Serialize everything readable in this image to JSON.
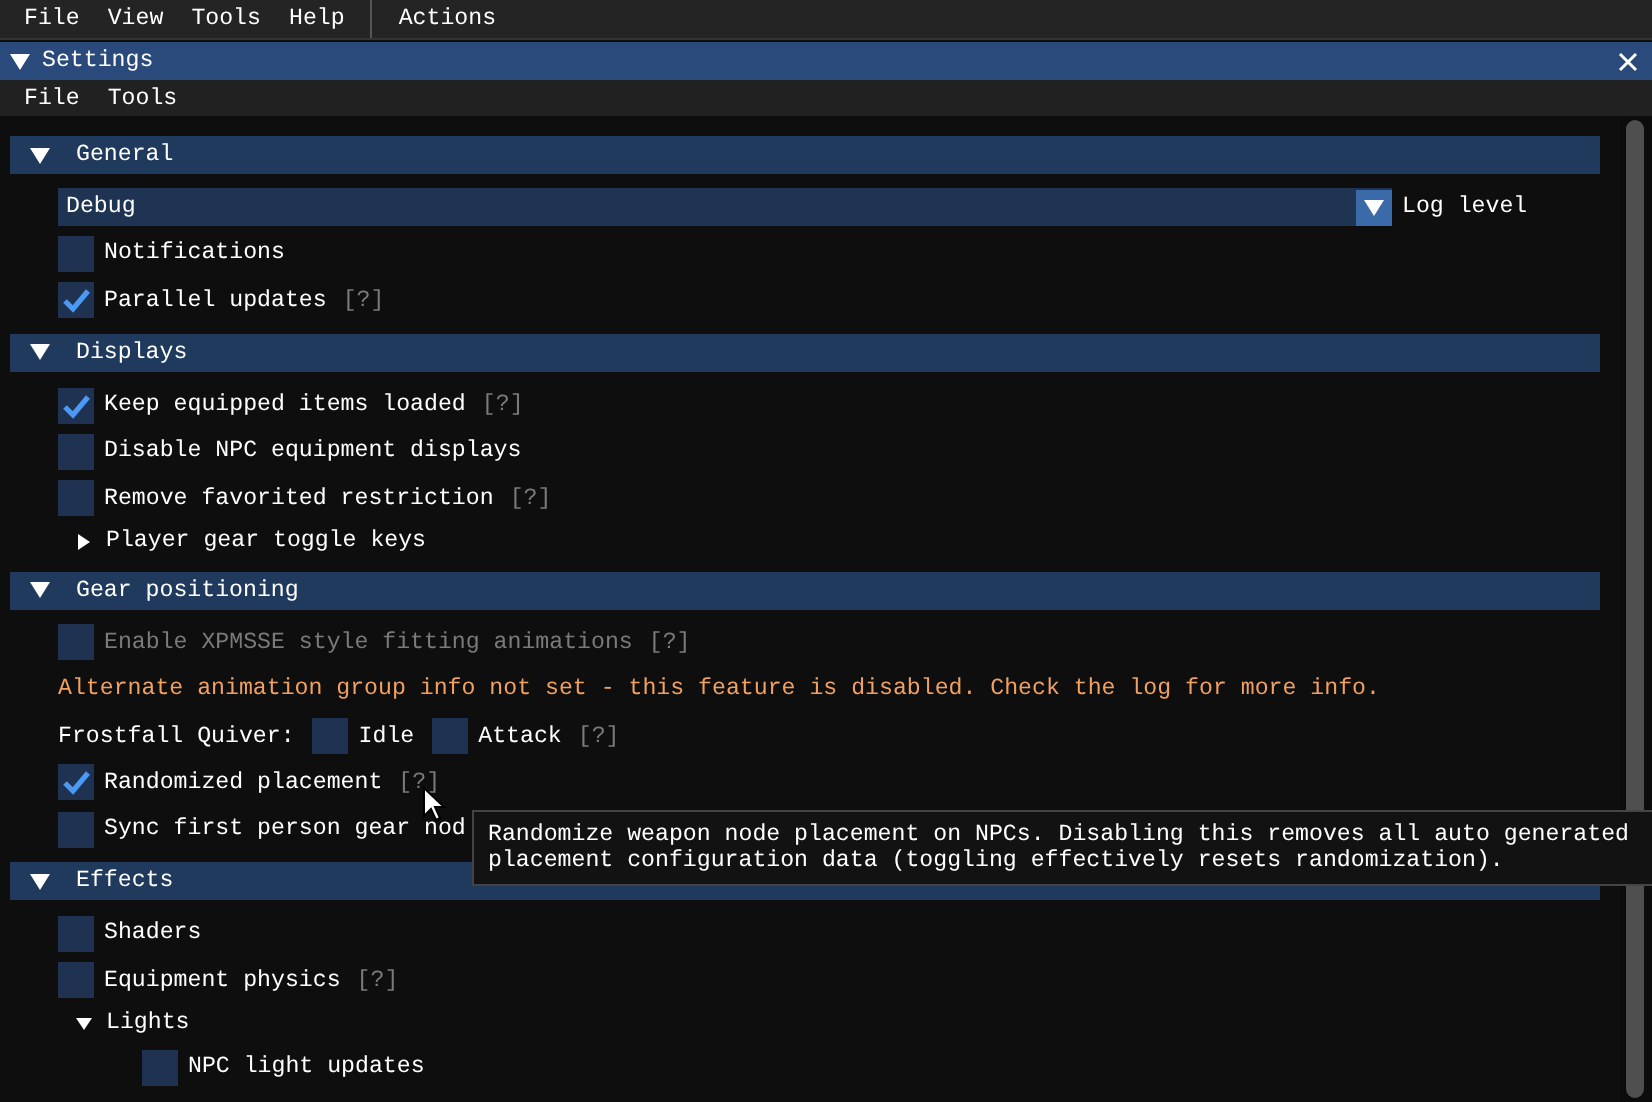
{
  "menu_bar": {
    "items": [
      "File",
      "View",
      "Tools",
      "Help"
    ],
    "actions": "Actions"
  },
  "window": {
    "title": "Settings",
    "expanded": true,
    "menu": [
      "File",
      "Tools"
    ]
  },
  "sections": [
    {
      "title": "General",
      "expanded": true,
      "items": [
        {
          "kind": "combo",
          "selection": "Debug",
          "label": "Log level"
        },
        {
          "kind": "checkbox",
          "label": "Notifications",
          "checked": false
        },
        {
          "kind": "checkbox",
          "label": "Parallel updates",
          "checked": true,
          "help": "[?]"
        }
      ]
    },
    {
      "title": "Displays",
      "expanded": true,
      "items": [
        {
          "kind": "checkbox",
          "label": "Keep equipped items loaded",
          "checked": true,
          "help": "[?]"
        },
        {
          "kind": "checkbox",
          "label": "Disable NPC equipment displays",
          "checked": false
        },
        {
          "kind": "checkbox",
          "label": "Remove favorited restriction",
          "checked": false,
          "help": "[?]"
        },
        {
          "kind": "tree",
          "label": "Player gear toggle keys",
          "expanded": false
        }
      ]
    },
    {
      "title": "Gear positioning",
      "expanded": true,
      "items": [
        {
          "kind": "checkbox",
          "label": "Enable XPMSSE style fitting animations",
          "checked": false,
          "disabled": true,
          "help": "[?]"
        },
        {
          "kind": "warning",
          "text": "Alternate animation group info not set - this feature is disabled. Check the log for more info."
        },
        {
          "kind": "inline",
          "label": "Frostfall Quiver:",
          "options": [
            {
              "label": "Idle",
              "checked": false
            },
            {
              "label": "Attack",
              "checked": false
            }
          ],
          "help": "[?]"
        },
        {
          "kind": "checkbox",
          "label": "Randomized placement",
          "checked": true,
          "help": "[?]"
        },
        {
          "kind": "checkbox",
          "label": "Sync first person gear nod",
          "checked": false
        }
      ]
    },
    {
      "title": "Effects",
      "expanded": true,
      "items": [
        {
          "kind": "checkbox",
          "label": "Shaders",
          "checked": false
        },
        {
          "kind": "checkbox",
          "label": "Equipment physics",
          "checked": false,
          "help": "[?]"
        },
        {
          "kind": "tree",
          "label": "Lights",
          "expanded": true,
          "children": [
            {
              "kind": "checkbox",
              "label": "NPC light updates",
              "checked": false
            }
          ]
        }
      ]
    }
  ],
  "tooltip": {
    "lines": [
      "Randomize weapon node placement on NPCs. Disabling this removes all auto generated",
      "placement configuration data (toggling effectively resets randomization)."
    ]
  }
}
